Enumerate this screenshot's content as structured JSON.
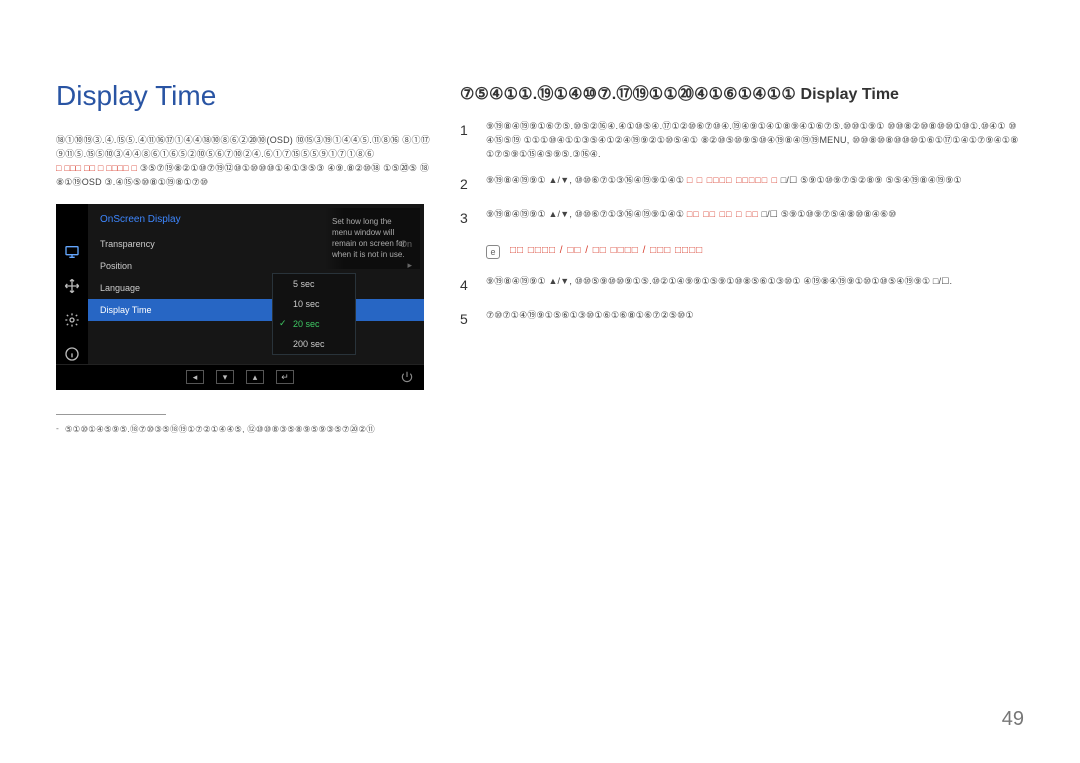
{
  "left": {
    "title": "Display Time",
    "para1": "⑱①⑩⑲③.④.⑮⑤.④⑪⑯⑰①④④⑱⑩⑧⑥②⑳⑩(OSD) ⑩⑮③⑲①④④⑤.⑪⑧⑯ ⑧①⑰⑨⑪⑤.⑮⑤⑩③④④⑧⑥①⑥⑤②⑩⑤⑥⑦⑩②④.⑥①⑦⑮⑤⑤⑨①⑦①⑧⑥",
    "para2_red": "□ □□□ □□ □ □□□□ □",
    "para2_tail": " ③⑤⑦⑲⑧②①⑩⑦⑲⑫⑩①⑩⑩⑩①④①③⑤③ ④⑨.⑧②⑩⑱ ①⑤⑳⑤ ⑱⑧①⑲OSD ③.④⑮⑤⑩⑧①⑲⑧①⑦⑩",
    "footnote": "⑤①⑩①④⑤⑨⑤.⑱⑦⑩③⑤⑱⑲①⑦②①④④⑤, ⑫⑩⑩⑧③⑤⑧⑨⑤⑨③⑤⑦⑳②⑪"
  },
  "osd": {
    "title": "OnScreen Display",
    "items": [
      {
        "label": "Transparency",
        "value": "On"
      },
      {
        "label": "Position",
        "value": "▸"
      },
      {
        "label": "Language",
        "value": ""
      },
      {
        "label": "Display Time",
        "value": ""
      }
    ],
    "options": [
      "5 sec",
      "10 sec",
      "20 sec",
      "200 sec"
    ],
    "selected_option": "20 sec",
    "desc": "Set how long the menu window will remain on screen for when it is not in use.",
    "nav": {
      "left": "◂",
      "down": "▾",
      "up": "▴",
      "enter": "↵",
      "power": "⏻"
    }
  },
  "right": {
    "heading_prefix": "⑦⑤④①①.⑲①④⑩⑦.⑰⑲①①⑳④①⑥①④①① ",
    "heading_main": "Display Time",
    "steps": [
      {
        "n": "1",
        "body": "⑨⑲⑧④⑲⑨①⑥⑦⑤.⑩⑤②⑯④.④①⑩⑤④.⑰①②⑩⑥⑦⑩④.⑲④⑨①④①⑧⑨④①⑥⑦⑤.⑩⑩①⑨① ⑩⑩⑧②⑩⑧⑩⑩①⑩①.⑩④① ⑩④⑮⑤⑲ ①①①⑩④①①③⑤④①②④⑲⑨②①⑩⑤④① ⑧②⑩⑤⑩⑨⑤⑩④⑲⑧④⑲⑲MENU, ⑩⑩⑧⑩⑧⑩⑩⑩①⑥①⑰①④①⑦⑨④①⑧①⑦⑤⑨①⑮④⑤⑨⑤.③⑯④."
      },
      {
        "n": "2",
        "body_pre": "⑨⑲⑧④⑲⑨① ▲/▼, ⑩⑩⑥⑦①③⑯④⑲⑨①④①",
        "red": "□ □ □□□□ □□□□□ □",
        "body_post": " □/☐ ⑤⑨①⑩⑨⑦⑤②⑧⑨ ⑤⑤④⑲⑧④⑲⑨①"
      },
      {
        "n": "3",
        "body_pre": "⑨⑲⑧④⑲⑨① ▲/▼, ⑩⑩⑥⑦①③⑯④⑲⑨①④①",
        "red": "□□ □□ □□ □ □□",
        "body_post": " □/☐ ⑤⑨①⑩⑨⑦⑤④⑧⑩⑧④⑥⑩"
      },
      {
        "n": "4",
        "body": "⑨⑲⑧④⑲⑨① ▲/▼, ⑩⑩⑤⑨⑩⑩⑨①⑤.⑩②①④⑨⑨①⑤⑨①⑩⑧⑤⑥①③⑩① ④⑲⑧④⑲⑨①⑩①⑩⑤④⑲⑨① □/☐."
      },
      {
        "n": "5",
        "body": "⑦⑩⑦①④⑲⑨①⑤⑥①③⑩①⑥①⑥⑧①⑥⑦②⑤⑩①"
      }
    ],
    "info": {
      "icon": "e",
      "red": "□□ □□□□ / □□ / □□ □□□□ / □□□ □□□□"
    }
  },
  "page_number": "49"
}
